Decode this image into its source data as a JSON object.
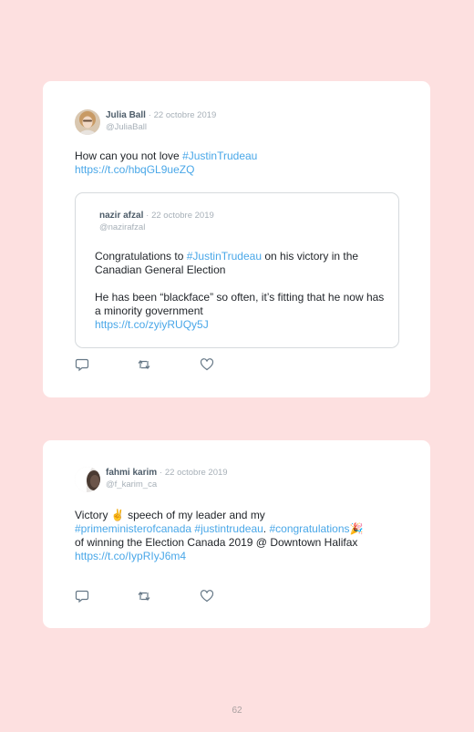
{
  "tweets": [
    {
      "author": "Julia Ball",
      "separator": "·",
      "date": "22 octobre 2019",
      "handle": "@JuliaBall",
      "text_prefix": "How can you not love ",
      "hashtag": "#JustinTrudeau",
      "link": "https://t.co/hbqGL9ueZQ",
      "quoted": {
        "author": "nazir afzal",
        "separator": "·",
        "date": "22 octobre 2019",
        "handle": "@nazirafzal",
        "p1_prefix": "Congratulations to ",
        "p1_hashtag": "#JustinTrudeau",
        "p1_suffix": " on his victory in the Canadian General Election",
        "p2_text": "He has been “blackface” so often, it’s fitting that he now has a minority government",
        "link": "https://t.co/zyiyRUQy5J"
      }
    },
    {
      "author": "fahmi karim",
      "separator": "·",
      "date": "22 octobre 2019",
      "handle": "@f_karim_ca",
      "text_prefix": "Victory ✌ speech of my leader and my ",
      "hashtag1": "#primeministerofcanada",
      "space1": " ",
      "hashtag2": "#justintrudeau",
      "period": ". ",
      "hashtag3": "#congratulations",
      "emoji": "🎉",
      "text_suffix": " of winning the Election Canada 2019 @ Downtown Halifax",
      "link": "https://t.co/IypRIyJ6m4"
    }
  ],
  "page_number": "62",
  "colors": {
    "background": "#fde0e0",
    "card": "#ffffff",
    "link": "#49a7e8",
    "muted": "#a7b0b8",
    "name": "#4d5c69"
  },
  "icons": [
    "reply-icon",
    "retweet-icon",
    "like-icon"
  ]
}
